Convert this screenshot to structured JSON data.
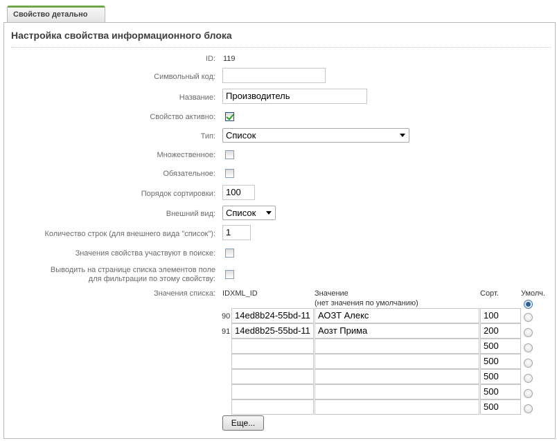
{
  "tab": {
    "label": "Свойство детально"
  },
  "panel_title": "Настройка свойства информационного блока",
  "fields": {
    "id": {
      "label": "ID:",
      "value": "119"
    },
    "code": {
      "label": "Символьный код:",
      "value": ""
    },
    "name": {
      "label": "Название:",
      "value": "Производитель"
    },
    "active": {
      "label": "Свойство активно:",
      "checked": true
    },
    "type": {
      "label": "Тип:",
      "value": "Список"
    },
    "multiple": {
      "label": "Множественное:",
      "checked": false
    },
    "required": {
      "label": "Обязательное:",
      "checked": false
    },
    "sort": {
      "label": "Порядок сортировки:",
      "value": "100"
    },
    "view": {
      "label": "Внешний вид:",
      "value": "Список"
    },
    "rows": {
      "label": "Количество строк (для внешнего вида \"список\"):",
      "value": "1"
    },
    "search": {
      "label": "Значения свойства участвуют в поиске:",
      "checked": false
    },
    "filter": {
      "label_line1": "Выводить на странице списка элементов поле",
      "label_line2": "для фильтрации по этому свойству:",
      "checked": false
    }
  },
  "values_list": {
    "label": "Значения списка:",
    "headers": {
      "xml_id": "IDXML_ID",
      "value_line1": "Значение",
      "value_line2": "(нет значения по умолчанию)",
      "sort": "Сорт.",
      "default": "Умолч."
    },
    "rows": [
      {
        "id": "90",
        "xml_id": "14ed8b24-55bd-11",
        "value": "АОЗТ Алекс",
        "sort": "100"
      },
      {
        "id": "91",
        "xml_id": "14ed8b25-55bd-11",
        "value": "Аозт Прима",
        "sort": "200"
      },
      {
        "id": "",
        "xml_id": "",
        "value": "",
        "sort": "500"
      },
      {
        "id": "",
        "xml_id": "",
        "value": "",
        "sort": "500"
      },
      {
        "id": "",
        "xml_id": "",
        "value": "",
        "sort": "500"
      },
      {
        "id": "",
        "xml_id": "",
        "value": "",
        "sort": "500"
      },
      {
        "id": "",
        "xml_id": "",
        "value": "",
        "sort": "500"
      }
    ],
    "more_button": "Еще..."
  }
}
